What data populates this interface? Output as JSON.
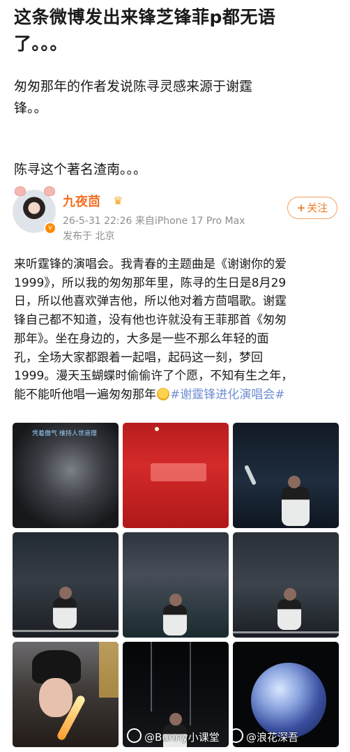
{
  "headline": {
    "line1": "这条微博发出来锋芝锋菲p都无语",
    "line2": "了。。。"
  },
  "intro": {
    "line1": "匆匆那年的作者发说陈寻灵感来源于谢霆",
    "line1b": "锋。。",
    "line2": "陈寻这个著名渣南。。。"
  },
  "profile": {
    "username": "九夜茴",
    "crown_icon": "crown-icon",
    "meta": "26-5-31 22:26  来自iPhone 17 Pro Max",
    "location": "发布于 北京",
    "follow_label": "关注",
    "follow_plus": "+",
    "accent_color": "#f26f22"
  },
  "post": {
    "lines": [
      "来听霆锋的演唱会。我青春的主题曲是《谢谢你的爱",
      "1999》，所以我的匆匆那年里，陈寻的生日是8月29",
      "日，所以他喜欢弹吉他，所以他对着方茴唱歌。谢霆",
      "锋自己都不知道，没有他也许就没有王菲那首《匆匆",
      "那年》。坐在身边的，大多是一些不那么年轻的面",
      "孔，全场大家都跟着一起唱，起码这一刻，梦回",
      "1999。漫天玉蝴蝶时偷偷许了个愿，不知有生之年，",
      "能不能听他唱一遍匆匆那年"
    ],
    "hashtag": "#谢霆锋进化演唱会#",
    "emoji_icon": "thinking-face-icon",
    "hashtag_color": "#6f8fd2"
  },
  "photos": {
    "caption_tile1": "凭着傲气 维持人世道理",
    "watermark1": "@Bunny小课堂",
    "watermark2": "@浪花深吾"
  }
}
